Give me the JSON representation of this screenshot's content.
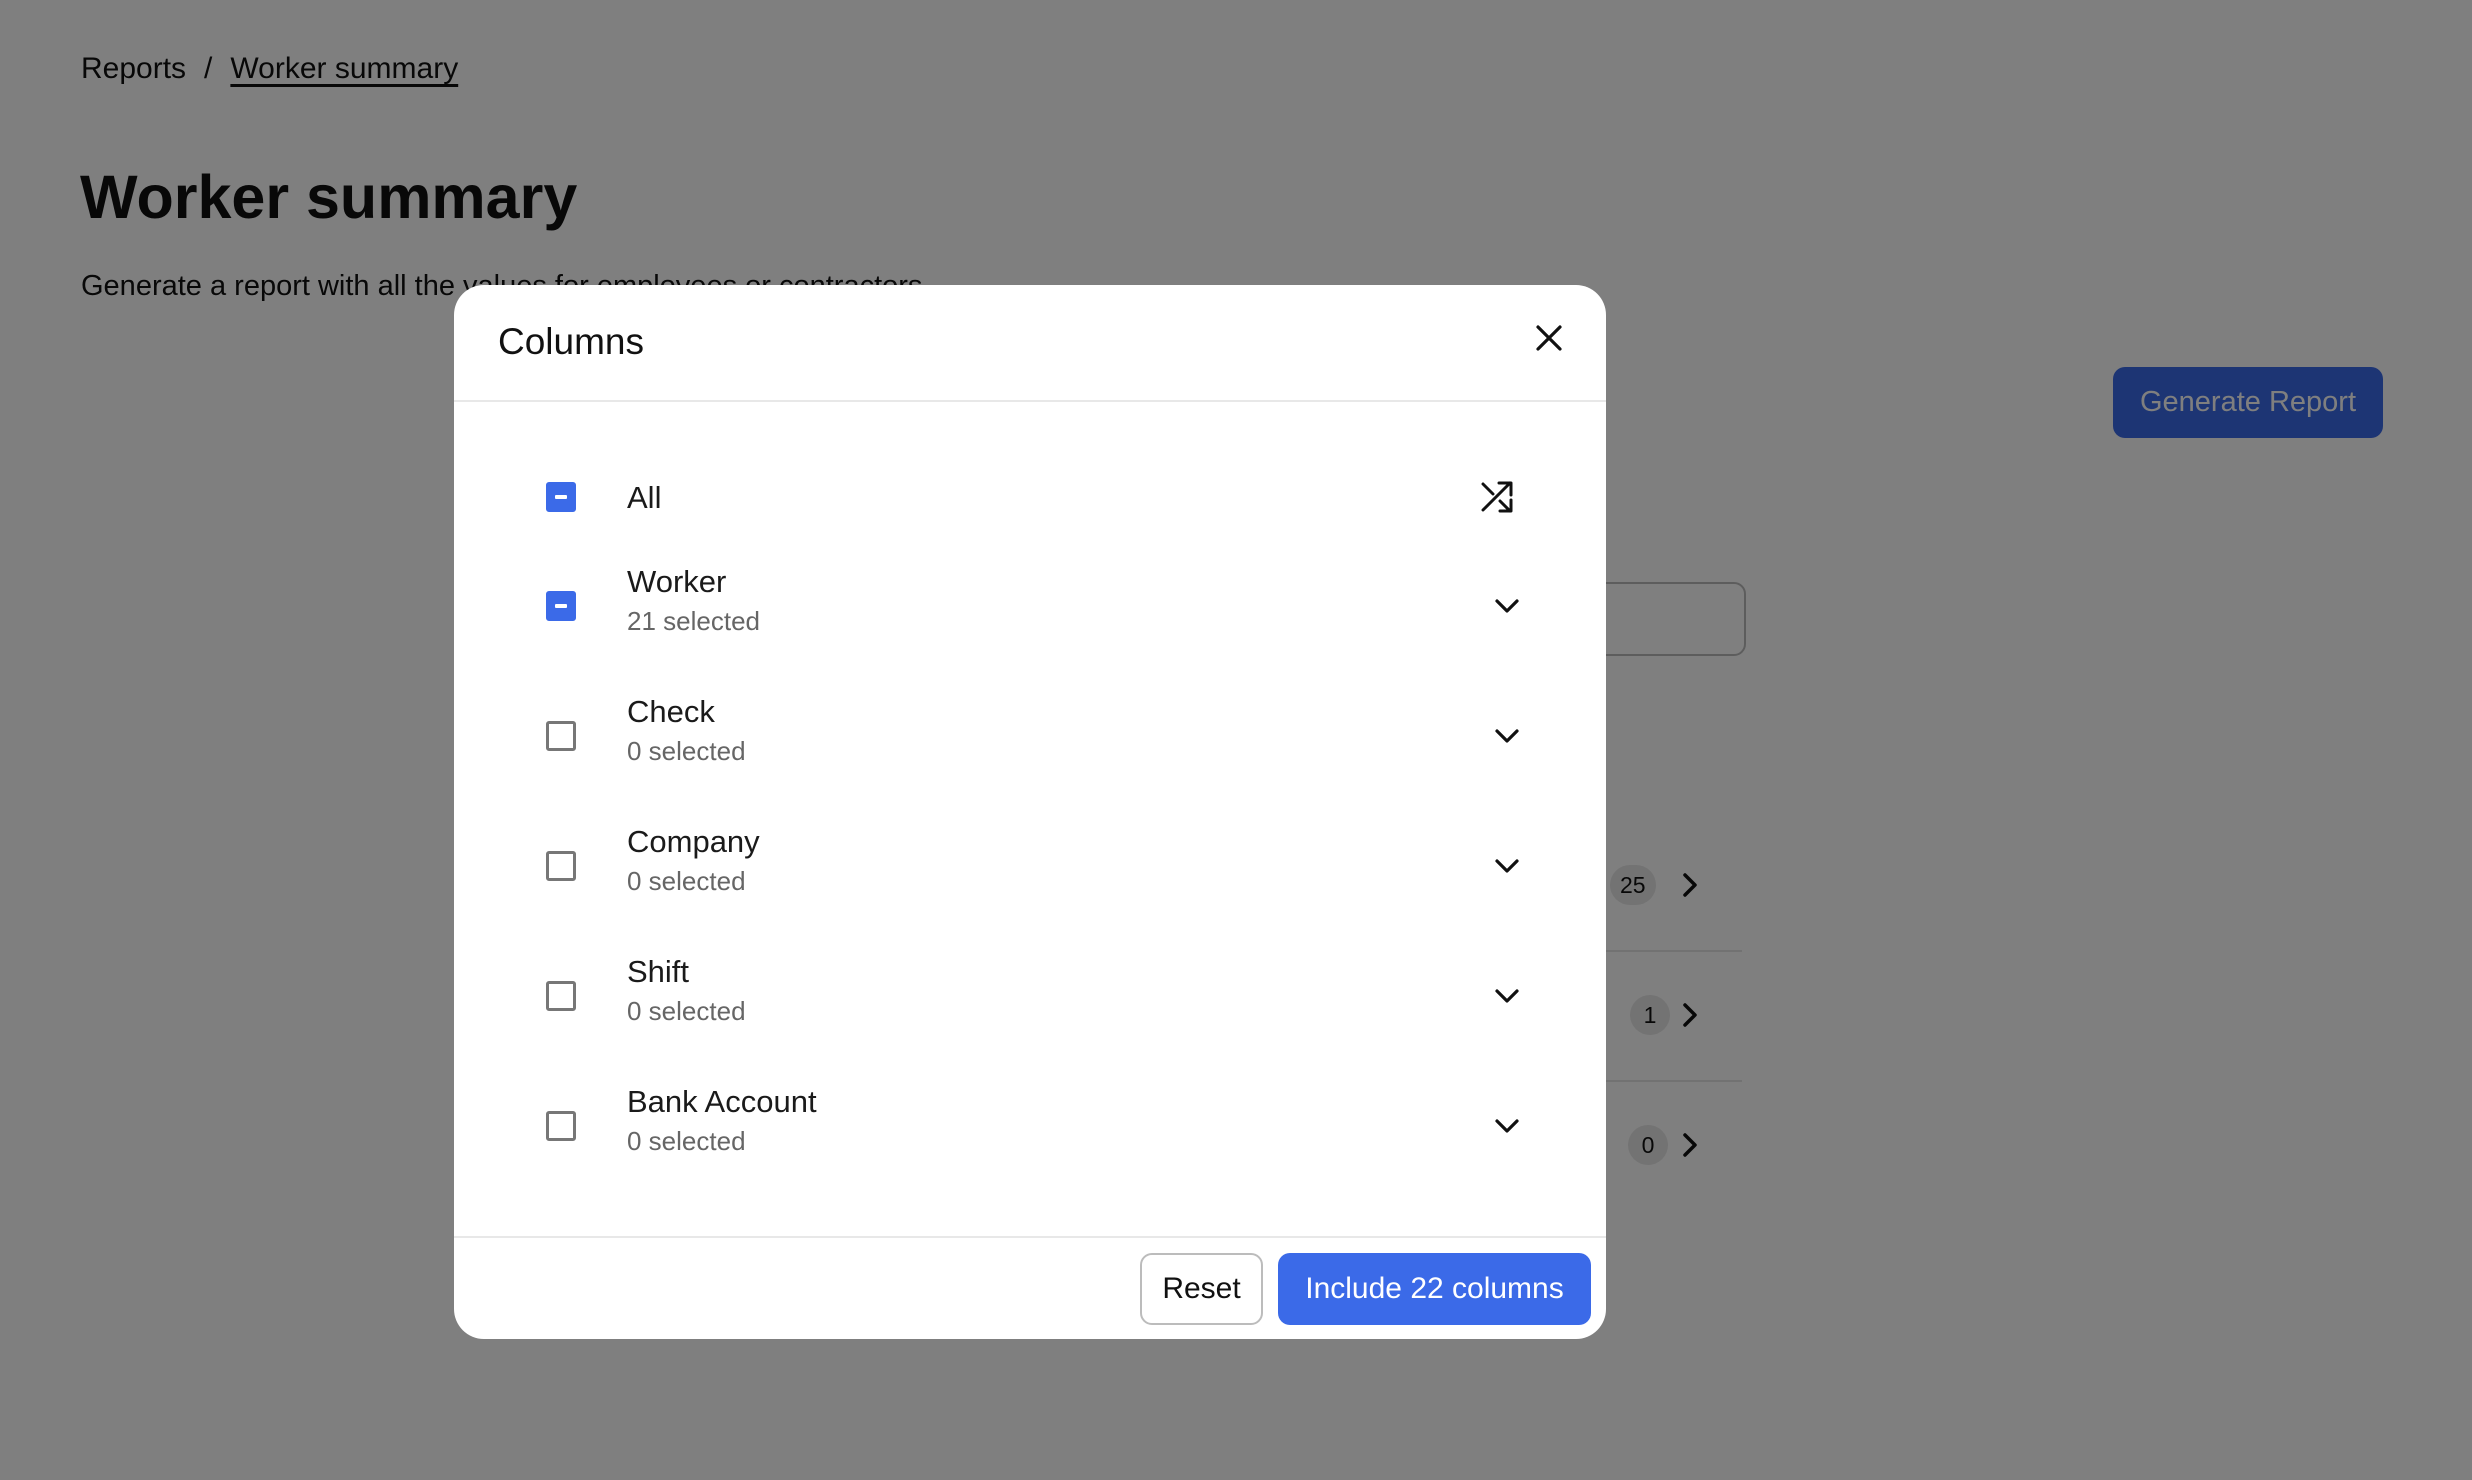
{
  "breadcrumb": {
    "parent": "Reports",
    "separator": "/",
    "current": "Worker summary"
  },
  "page": {
    "title": "Worker summary",
    "description": "Generate a report with all the values for employees or contractors",
    "generate_button": "Generate Report",
    "background_counts": [
      "25",
      "1",
      "0"
    ]
  },
  "modal": {
    "title": "Columns",
    "close_icon": "close-icon",
    "all_label": "All",
    "shuffle_icon": "shuffle-icon",
    "groups": [
      {
        "label": "Worker",
        "sub": "21 selected",
        "state": "indeterminate"
      },
      {
        "label": "Check",
        "sub": "0 selected",
        "state": "unchecked"
      },
      {
        "label": "Company",
        "sub": "0 selected",
        "state": "unchecked"
      },
      {
        "label": "Shift",
        "sub": "0 selected",
        "state": "unchecked"
      },
      {
        "label": "Bank Account",
        "sub": "0 selected",
        "state": "unchecked"
      }
    ],
    "reset_button": "Reset",
    "include_button": "Include 22 columns"
  },
  "colors": {
    "accent": "#3b6ae8",
    "overlay": "rgba(0,0,0,0.5)"
  }
}
